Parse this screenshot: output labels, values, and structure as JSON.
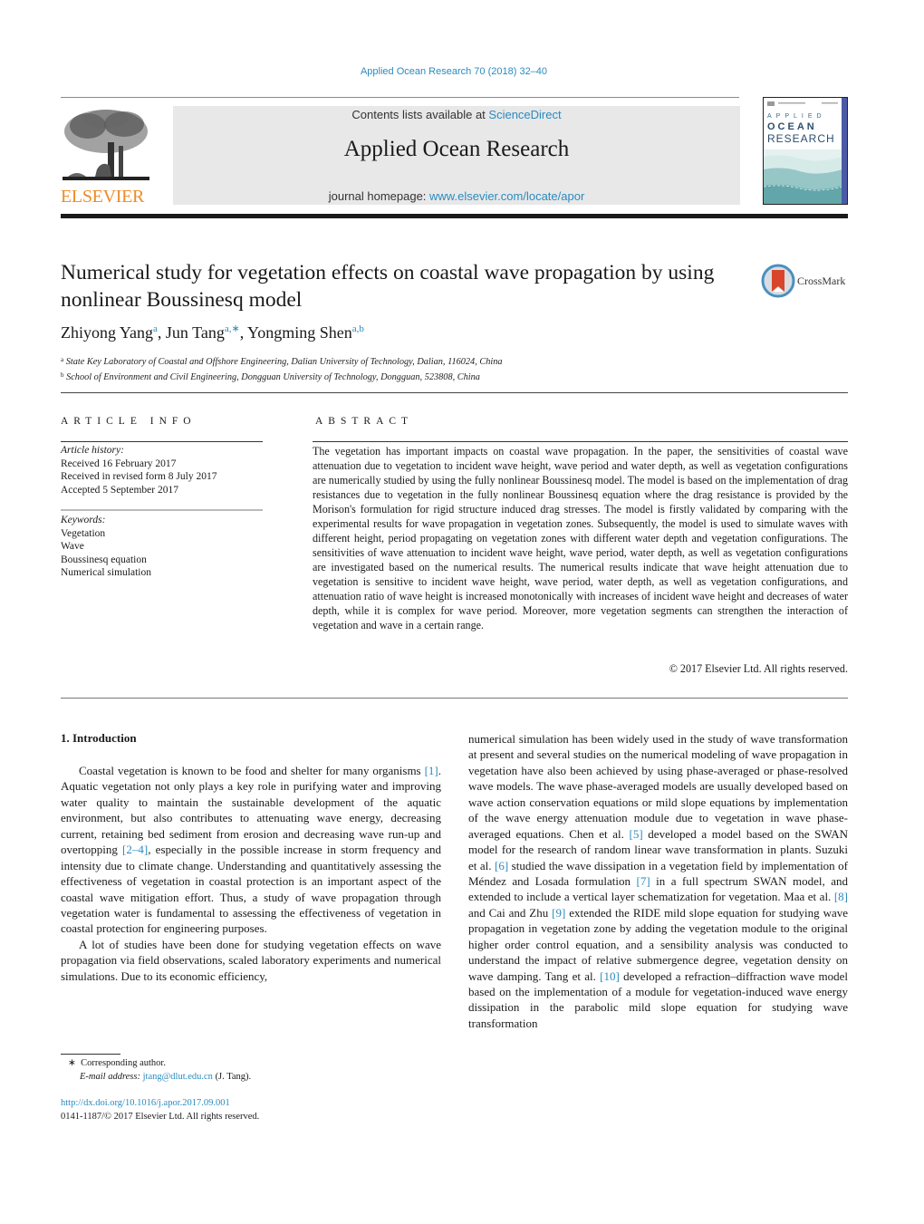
{
  "journal_ref": "Applied Ocean Research 70 (2018) 32–40",
  "publisher": {
    "logo_word": "ELSEVIER",
    "brand_color": "#f08a25"
  },
  "masthead": {
    "contents_prefix": "Contents lists available at ",
    "contents_link": "ScienceDirect",
    "journal_title": "Applied Ocean Research",
    "homepage_prefix": "journal homepage: ",
    "homepage_link": "www.elsevier.com/locate/apor"
  },
  "cover": {
    "line1": "APPLIED",
    "line2": "OCEAN",
    "line3": "RESEARCH"
  },
  "article": {
    "title": "Numerical study for vegetation effects on coastal wave propagation by using nonlinear Boussinesq model",
    "crossmark_label": "CrossMark",
    "authors": [
      {
        "name": "Zhiyong Yang",
        "sup": "a"
      },
      {
        "name": "Jun Tang",
        "sup": "a,∗"
      },
      {
        "name": "Yongming Shen",
        "sup": "a,b"
      }
    ],
    "affiliations": [
      {
        "sup": "a",
        "text": "State Key Laboratory of Coastal and Offshore Engineering, Dalian University of Technology, Dalian, 116024, China"
      },
      {
        "sup": "b",
        "text": "School of Environment and Civil Engineering, Dongguan University of Technology, Dongguan, 523808, China"
      }
    ]
  },
  "article_info": {
    "label": "ARTICLE INFO",
    "history_head": "Article history:",
    "history": [
      "Received 16 February 2017",
      "Received in revised form 8 July 2017",
      "Accepted 5 September 2017"
    ],
    "keywords_head": "Keywords:",
    "keywords": [
      "Vegetation",
      "Wave",
      "Boussinesq equation",
      "Numerical simulation"
    ]
  },
  "abstract": {
    "label": "ABSTRACT",
    "text": "The vegetation has important impacts on coastal wave propagation. In the paper, the sensitivities of coastal wave attenuation due to vegetation to incident wave height, wave period and water depth, as well as vegetation configurations are numerically studied by using the fully nonlinear Boussinesq model. The model is based on the implementation of drag resistances due to vegetation in the fully nonlinear Boussinesq equation where the drag resistance is provided by the Morison's formulation for rigid struc­ture induced drag stresses. The model is firstly validated by comparing with the experimental results for wave propagation in vegetation zones. Subsequently, the model is used to simulate waves with different height, period propagating on vegetation zones with different water depth and vegetation configura­tions. The sensitivities of wave attenuation to incident wave height, wave period, water depth, as well as vegetation configurations are investigated based on the numerical results. The numerical results indicate that wave height attenuation due to vegetation is sensitive to incident wave height, wave period, water depth, as well as vegetation configurations, and attenuation ratio of wave height is increased monotoni­cally with increases of incident wave height and decreases of water depth, while it is complex for wave period. Moreover, more vegetation segments can strengthen the interaction of vegetation and wave in a certain range.",
    "copyright": "© 2017 Elsevier Ltd. All rights reserved."
  },
  "introduction": {
    "heading": "1.  Introduction",
    "p1_a": "Coastal vegetation is known to be food and shelter for many organisms ",
    "p1_ref1": "[1]",
    "p1_b": ". Aquatic vegetation not only plays a key role in purify­ing water and improving water quality to maintain the sustainable development of the aquatic environment, but also contributes to attenuating wave energy, decreasing current, retaining bed sedi­ment from erosion and decreasing wave run-up and overtopping ",
    "p1_ref2": "[2–4]",
    "p1_c": ", especially in the possible increase in storm frequency and intensity due to climate change. Understanding and quantitatively assessing the effectiveness of vegetation in coastal protection is an important aspect of the coastal wave mitigation effort. Thus, a study of wave propagation through vegetation water is fundamental to assessing the effectiveness of vegetation in coastal protection for engineering purposes.",
    "p2": "A lot of studies have been done for studying vegetation effects on wave propagation via field observations, scaled laboratory exper­iments and numerical simulations. Due to its economic efficiency,",
    "r_a": "numerical simulation has been widely used in the study of wave transformation at present and several studies on the numeri­cal modeling of wave propagation in vegetation have also been achieved by using phase-averaged or phase-resolved wave mod­els. The wave phase-averaged models are usually developed based on wave action conservation equations or mild slope equations by implementation of the wave energy attenuation module due to vegetation in wave phase-averaged equations. Chen et al. ",
    "r_ref5": "[5]",
    "r_b": " developed a model based on the SWAN model for the research of random linear wave transformation in plants. Suzuki et al. ",
    "r_ref6": "[6]",
    "r_c": " studied the wave dissipation in a vegetation field by implemen­tation of Méndez and Losada formulation ",
    "r_ref7": "[7]",
    "r_d": " in a full spectrum SWAN model, and extended to include a vertical layer schemati­zation for vegetation. Maa et al. ",
    "r_ref8": "[8]",
    "r_e": " and Cai and Zhu ",
    "r_ref9": "[9]",
    "r_f": " extended the RIDE mild slope equation for studying wave propagation in vegetation zone by adding the vegetation module to the original higher order control equation, and a sensibility analysis was con­ducted to understand the impact of relative submergence degree, vegetation density on wave damping. Tang et al. ",
    "r_ref10": "[10]",
    "r_g": " developed a refraction–diffraction wave model based on the implementation of a module for vegetation-induced wave energy dissipation in the parabolic mild slope equation for studying wave transformation"
  },
  "footnotes": {
    "star": "∗",
    "corresponding": "Corresponding author.",
    "email_label": "E-mail address: ",
    "email": "jtang@dlut.edu.cn",
    "email_suffix": " (J. Tang).",
    "doi": "http://dx.doi.org/10.1016/j.apor.2017.09.001",
    "issn_line": "0141-1187/© 2017 Elsevier Ltd. All rights reserved."
  },
  "colors": {
    "link": "#2a8bc0",
    "masthead_bg": "#e8e8e8",
    "crossmark_red": "#d9452b",
    "crossmark_ring": "#4b8fbf"
  }
}
